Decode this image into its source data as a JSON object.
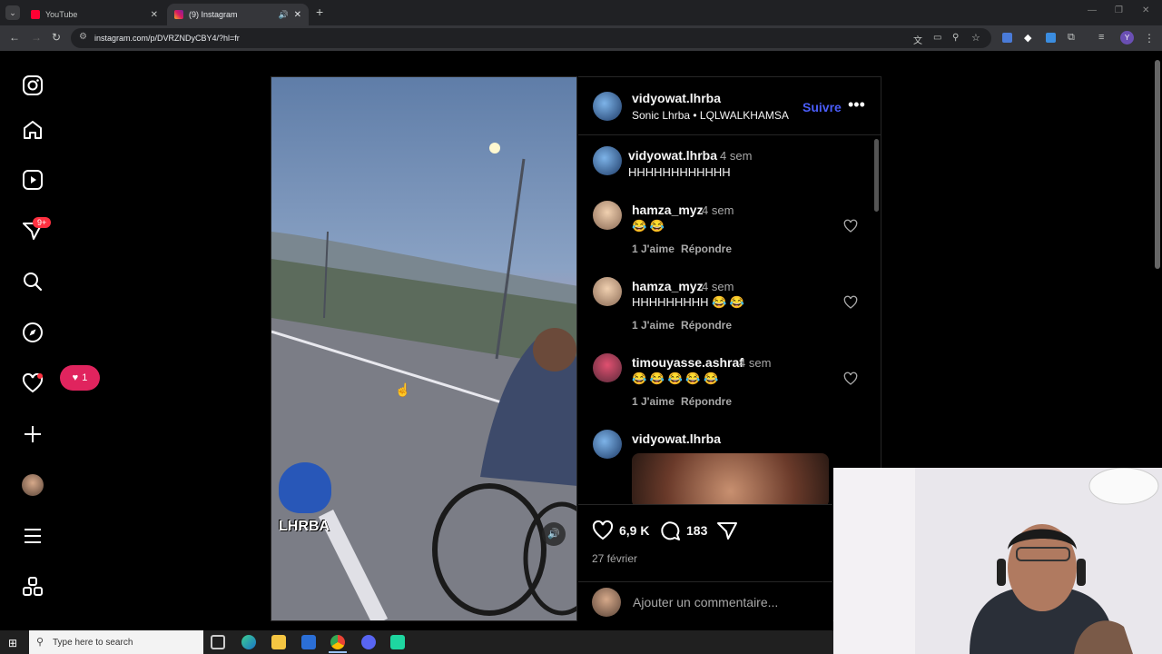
{
  "browser": {
    "tabs": [
      {
        "label": "YouTube",
        "icon": "youtube-icon"
      },
      {
        "label": "(9) Instagram",
        "icon": "instagram-icon"
      }
    ],
    "url": "instagram.com/p/DVRZNDyCBY4/?hl=fr"
  },
  "sidebar": {
    "messages_badge": "9+",
    "notif_count": "1"
  },
  "post": {
    "author": "vidyowat.lhrba",
    "audio": "Sonic Lhrba • LQLWALKHAMSA",
    "follow_label": "Suivre",
    "watermark": "LHRBA"
  },
  "comments": [
    {
      "user": "vidyowat.lhrba",
      "time": "4 sem",
      "text": "HHHHHHHHHHHH"
    },
    {
      "user": "hamza_myz",
      "time": "4 sem",
      "text": "😂 😂",
      "likes": "1 J'aime",
      "reply": "Répondre"
    },
    {
      "user": "hamza_myz",
      "time": "4 sem",
      "text": "HHHHHHHHH 😂 😂",
      "likes": "1 J'aime",
      "reply": "Répondre"
    },
    {
      "user": "timouyasse.ashraf",
      "time": "4 sem",
      "text": "😂 😂 😂 😂 😂",
      "likes": "1 J'aime",
      "reply": "Répondre"
    },
    {
      "user": "vidyowat.lhrba",
      "time": "",
      "text": ""
    }
  ],
  "stats": {
    "likes": "6,9 K",
    "comments": "183",
    "date": "27 février"
  },
  "add_comment_placeholder": "Ajouter un commentaire...",
  "taskbar": {
    "search_placeholder": "Type here to search"
  },
  "colors": {
    "accent": "#4a5df9",
    "notif": "#e0245e"
  }
}
